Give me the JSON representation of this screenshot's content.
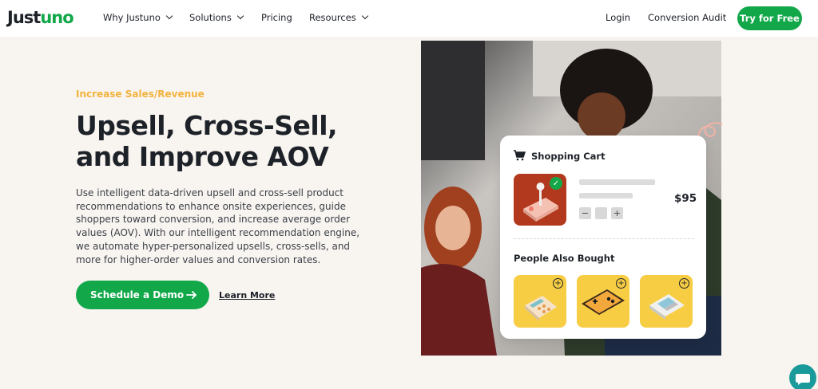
{
  "nav": {
    "logo_part1": "Just",
    "logo_part2": "uno",
    "why": "Why Justuno",
    "solutions": "Solutions",
    "pricing": "Pricing",
    "resources": "Resources",
    "login": "Login",
    "audit": "Conversion Audit",
    "try": "Try for Free"
  },
  "hero": {
    "eyebrow": "Increase Sales/Revenue",
    "headline": "Upsell, Cross-Sell, and Improve AOV",
    "body": "Use intelligent data-driven upsell and cross-sell product recommendations to enhance onsite experiences, guide shoppers toward conversion, and increase average order values (AOV). With our intelligent recommendation engine, we automate hyper-personalized upsells, cross-sells, and more for higher-order values and conversion rates.",
    "demo": "Schedule a Demo",
    "learn": "Learn More"
  },
  "cart": {
    "title": "Shopping Cart",
    "minus": "−",
    "plus": "+",
    "price": "$95",
    "also_bought": "People Also Bought",
    "add": "+"
  },
  "icons": {
    "cart": "shopping-cart-icon",
    "check": "check-icon",
    "arrow": "arrow-right-icon",
    "chat": "chat-icon"
  },
  "colors": {
    "brand_green": "#12a84a",
    "accent_yellow": "#f3b33d",
    "background": "#f8f4f0"
  }
}
